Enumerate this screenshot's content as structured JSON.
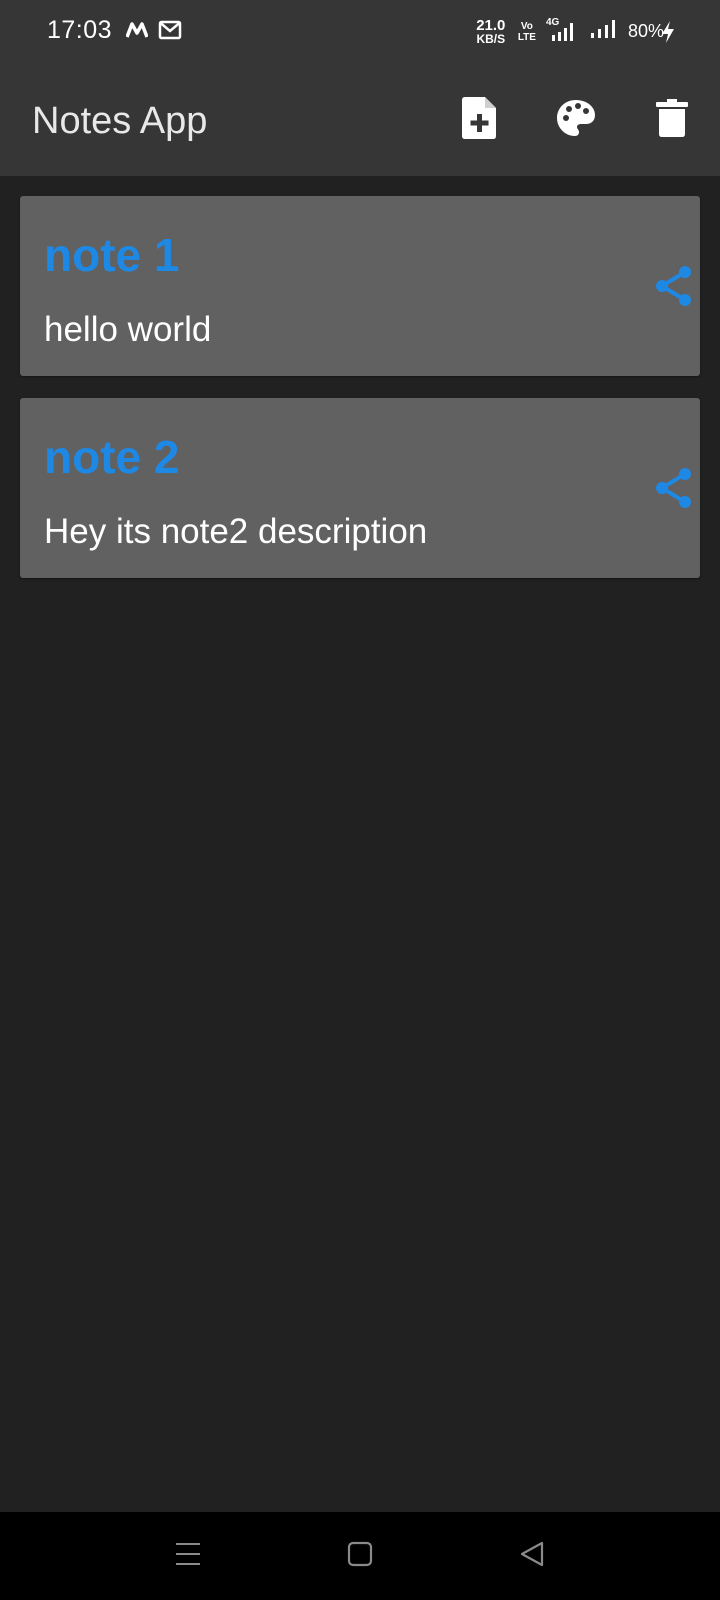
{
  "status_bar": {
    "time": "17:03",
    "app_icons": [
      "m-icon",
      "gmail-icon"
    ],
    "net_speed_value": "21.0",
    "net_speed_unit": "KB/S",
    "volte_line1": "Vo",
    "volte_line2": "LTE",
    "network_type": "4G",
    "battery_percent": "80%",
    "charging": true
  },
  "app_bar": {
    "title": "Notes App",
    "actions": [
      {
        "name": "add-note-icon"
      },
      {
        "name": "palette-icon"
      },
      {
        "name": "delete-icon"
      }
    ]
  },
  "notes": [
    {
      "title": "note 1",
      "description": "hello world"
    },
    {
      "title": "note 2",
      "description": "Hey its note2 description"
    }
  ],
  "colors": {
    "accent": "#1e88e5",
    "app_bar": "#363636",
    "background": "#212121",
    "card": "#616161"
  },
  "nav_bar": {
    "buttons": [
      "menu-icon",
      "home-icon",
      "back-icon"
    ]
  }
}
